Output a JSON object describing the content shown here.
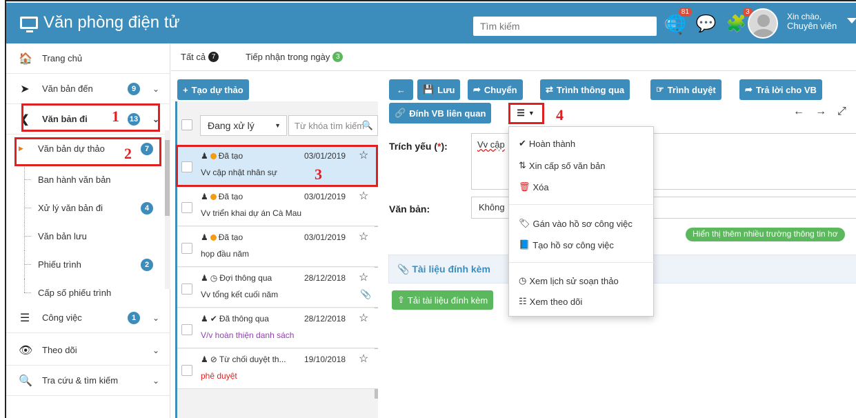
{
  "header": {
    "title": "Văn phòng điện tử",
    "search_placeholder": "Tìm kiếm",
    "notif_badge": "81",
    "puzzle_badge": "3",
    "greeting": "Xin chào,",
    "user_name": "Chuyên viên"
  },
  "sidebar": {
    "items": [
      {
        "label": "Trang chủ"
      },
      {
        "label": "Văn bản đến",
        "count": "9"
      },
      {
        "label": "Văn bản đi",
        "count": "13"
      },
      {
        "label": "Công việc",
        "count": "1"
      },
      {
        "label": "Theo dõi"
      },
      {
        "label": "Tra cứu & tìm kiếm"
      }
    ],
    "subitems": [
      {
        "label": "Văn bản dự thảo",
        "count": "7"
      },
      {
        "label": "Ban hành văn bản"
      },
      {
        "label": "Xử lý văn bản đi",
        "count": "4"
      },
      {
        "label": "Văn bản lưu"
      },
      {
        "label": "Phiếu trình",
        "count": "2"
      },
      {
        "label": "Cấp số phiếu trình"
      }
    ]
  },
  "tabs": [
    {
      "label": "Tất cả",
      "count": "7"
    },
    {
      "label": "Tiếp nhận trong ngày",
      "count": "3"
    }
  ],
  "list": {
    "create_button": "Tạo dự thảo",
    "filter_value": "Đang xử lý",
    "keyword_placeholder": "Từ khóa tìm kiếm",
    "rows": [
      {
        "status": "Đã tạo",
        "date": "03/01/2019",
        "title": "Vv cập nhật nhân sự",
        "title_color": "#333"
      },
      {
        "status": "Đã tạo",
        "date": "03/01/2019",
        "title": "Vv triển khai dự án Cà Mau",
        "title_color": "#333"
      },
      {
        "status": "Đã tạo",
        "date": "03/01/2019",
        "title": "họp đầu năm",
        "title_color": "#333"
      },
      {
        "status": "Đợi thông qua",
        "date": "28/12/2018",
        "title": "Vv tổng kết cuối năm",
        "title_color": "#333"
      },
      {
        "status": "Đã thông qua",
        "date": "28/12/2018",
        "title": "V/v hoàn thiện danh sách",
        "title_color": "#8e44ad"
      },
      {
        "status": "Từ chối duyệt th...",
        "date": "19/10/2018",
        "title": "phê duyệt",
        "title_color": "#e02020"
      }
    ]
  },
  "toolbar": {
    "save": "Lưu",
    "forward": "Chuyển",
    "submit": "Trình thông qua",
    "approve": "Trình duyệt",
    "reply": "Trả lời cho VB",
    "attach_related": "Đính VB liên quan"
  },
  "form": {
    "summary_label": "Trích yếu (",
    "summary_star": "*",
    "summary_label_end": "):",
    "summary_value": "Vv cập",
    "doc_label": "Văn bản:",
    "doc_value": "Không",
    "more_fields": "Hiển thị thêm nhiều trường thông tin hơ",
    "attachments_title": "Tài liệu đính kèm",
    "upload_button": "Tải tài liệu đính kèm"
  },
  "menu": {
    "items": [
      "Hoàn thành",
      "Xin cấp số văn bản",
      "Xóa",
      "Gán vào hồ sơ công việc",
      "Tạo hồ sơ công việc",
      "Xem lịch sử soạn thảo",
      "Xem theo dõi"
    ]
  },
  "annotations": [
    "1",
    "2",
    "3",
    "4"
  ],
  "colors": {
    "primary": "#3c8dbc",
    "success": "#5cb85c",
    "annotation": "#e02020"
  }
}
